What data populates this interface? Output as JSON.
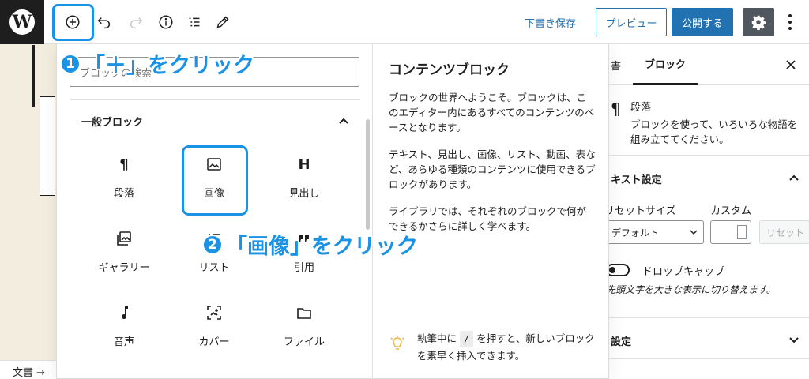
{
  "toolbar": {
    "logo_letter": "W",
    "draft_label": "下書き保存",
    "preview_label": "プレビュー",
    "publish_label": "公開する",
    "accent": "#2271b1"
  },
  "breadcrumb": {
    "label": "文書 →"
  },
  "inserter": {
    "search_placeholder": "ブロックの検索",
    "category_title": "一般ブロック",
    "blocks": [
      {
        "label": "段落",
        "icon": "paragraph-icon"
      },
      {
        "label": "画像",
        "icon": "image-icon"
      },
      {
        "label": "見出し",
        "icon": "heading-icon"
      },
      {
        "label": "ギャラリー",
        "icon": "gallery-icon"
      },
      {
        "label": "リスト",
        "icon": "list-icon"
      },
      {
        "label": "引用",
        "icon": "quote-icon"
      },
      {
        "label": "音声",
        "icon": "audio-icon"
      },
      {
        "label": "カバー",
        "icon": "cover-icon"
      },
      {
        "label": "ファイル",
        "icon": "file-icon"
      }
    ],
    "preview": {
      "title": "コンテンツブロック",
      "p1": "ブロックの世界へようこそ。ブロックは、このエディター内にあるすべてのコンテンツのベースとなります。",
      "p2": "テキスト、見出し、画像、リスト、動画、表など、あらゆる種類のコンテンツに使用できるブロックがあります。",
      "p3": "ライブラリでは、それぞれのブロックで何ができるかさらに詳しく学べます。"
    },
    "tip": {
      "before": "執筆中に",
      "key": "/",
      "after": "を押すと、新しいブロックを素早く挿入できます。"
    }
  },
  "sidebar": {
    "tab_document": "書",
    "tab_block": "ブロック",
    "block_name": "段落",
    "block_icon": "¶",
    "block_desc": "ブロックを使って、いろいろな物語を組み立ててください。",
    "text_settings": "キスト設定",
    "preset_size_label": "リセットサイズ",
    "custom_label": "カスタム",
    "select_value": "デフォルト",
    "reset_label": "リセット",
    "dropcap_label": "ドロップキャップ",
    "dropcap_help": "先頭文字を大きな表示に切り替えます。",
    "color_settings": "設定"
  },
  "annotations": {
    "step1_num": "1",
    "step1_text": "「＋」をクリック",
    "step2_num": "2",
    "step2_text": "「画像」をクリック",
    "color": "#1a93e6"
  }
}
